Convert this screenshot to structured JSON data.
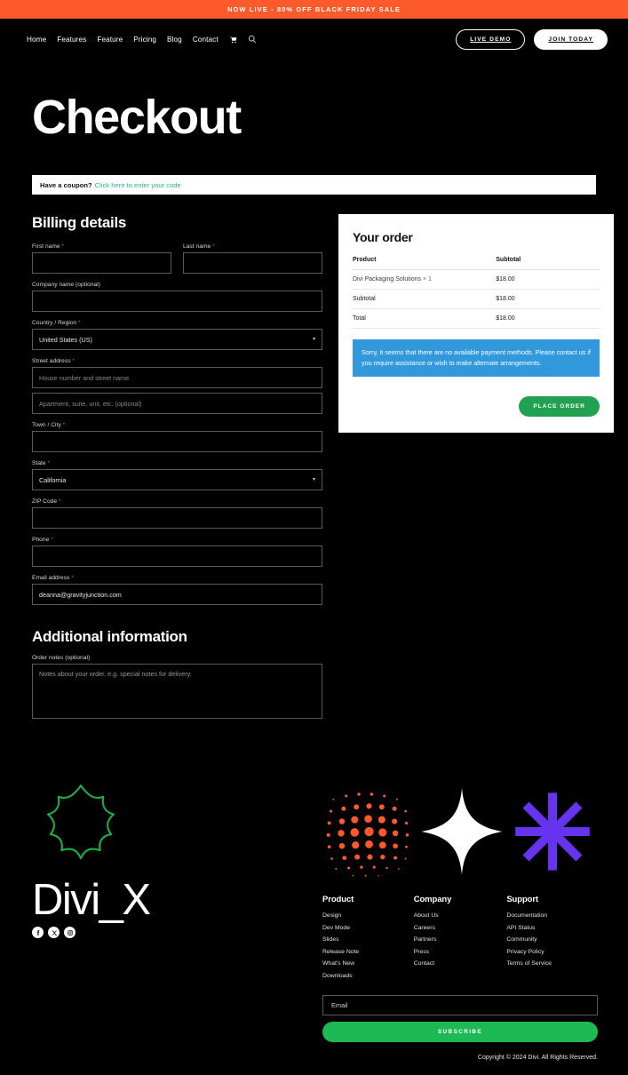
{
  "announcement": {
    "text": "NOW LIVE - 80% OFF BLACK FRIDAY SALE",
    "background": "#FF5A2B"
  },
  "nav": {
    "links": [
      {
        "label": "Home"
      },
      {
        "label": "Features"
      },
      {
        "label": "Feature"
      },
      {
        "label": "Pricing"
      },
      {
        "label": "Blog"
      },
      {
        "label": "Contact"
      }
    ],
    "cart_icon": "cart-icon",
    "search_icon": "search-icon",
    "live_demo_label": "LIVE DEMO",
    "join_today_label": "JOIN TODAY"
  },
  "page": {
    "title": "Checkout"
  },
  "coupon": {
    "prompt": "Have a coupon?",
    "link": "Click here to enter your code",
    "link_color": "#2fb67f"
  },
  "billing": {
    "title": "Billing details",
    "first_name": {
      "label": "First name",
      "required": true,
      "value": "",
      "placeholder": ""
    },
    "last_name": {
      "label": "Last name",
      "required": true,
      "value": "",
      "placeholder": ""
    },
    "company": {
      "label": "Company name (optional)",
      "required": false,
      "value": "",
      "placeholder": ""
    },
    "country": {
      "label": "Country / Region",
      "required": true,
      "value": "United States (US)"
    },
    "street": {
      "label": "Street address",
      "required": true,
      "line1_placeholder": "House number and street name",
      "line2_placeholder": "Apartment, suite, unit, etc. (optional)",
      "line1_value": "",
      "line2_value": ""
    },
    "city": {
      "label": "Town / City",
      "required": true,
      "value": ""
    },
    "state": {
      "label": "State",
      "required": true,
      "value": "California"
    },
    "zip": {
      "label": "ZIP Code",
      "required": true,
      "value": ""
    },
    "phone": {
      "label": "Phone",
      "required": true,
      "value": ""
    },
    "email": {
      "label": "Email address",
      "required": true,
      "value": "deanna@gravityjunction.com"
    }
  },
  "additional": {
    "title": "Additional information",
    "notes_label": "Order notes (optional)",
    "notes_placeholder": "Notes about your order, e.g. special notes for delivery.",
    "notes_value": ""
  },
  "order": {
    "title": "Your order",
    "columns": {
      "product": "Product",
      "subtotal": "Subtotal"
    },
    "items": [
      {
        "name": "Divi Packaging Solutions",
        "qty": "× 1",
        "amount": "$18.00"
      }
    ],
    "subtotal_label": "Subtotal",
    "subtotal_amount": "$18.00",
    "total_label": "Total",
    "total_amount": "$18.00",
    "notice": "Sorry, it seems that there are no available payment methods. Please contact us if you require assistance or wish to make alternate arrangements.",
    "notice_color": "#3298dc",
    "place_order_label": "PLACE ORDER",
    "place_order_color": "#22a153"
  },
  "footer": {
    "logo_icon": "pinwheel-logo-icon",
    "logo_color": "#1faa4b",
    "brand_name": "Divi_X",
    "socials": [
      {
        "name": "facebook-icon"
      },
      {
        "name": "x-twitter-icon"
      },
      {
        "name": "instagram-icon"
      }
    ],
    "decorations": [
      {
        "name": "halftone-dots-graphic",
        "color": "#FF5A2B"
      },
      {
        "name": "four-point-star-graphic",
        "color": "#ffffff"
      },
      {
        "name": "asterisk-graphic",
        "color": "#6633EE"
      }
    ],
    "columns": [
      {
        "title": "Product",
        "links": [
          "Design",
          "Dev Mode",
          "Slides",
          "Release Note",
          "What's New",
          "Downloads"
        ]
      },
      {
        "title": "Company",
        "links": [
          "About Us",
          "Careers",
          "Partners",
          "Press",
          "Contact"
        ]
      },
      {
        "title": "Support",
        "links": [
          "Documentation",
          "API Status",
          "Community",
          "Privacy Policy",
          "Terms of Service"
        ]
      }
    ],
    "newsletter": {
      "placeholder": "Email",
      "value": "",
      "button_label": "SUBSCRIBE",
      "button_color": "#1db954"
    },
    "copyright": "Copyright © 2024 Divi. All Rights Reserved."
  }
}
